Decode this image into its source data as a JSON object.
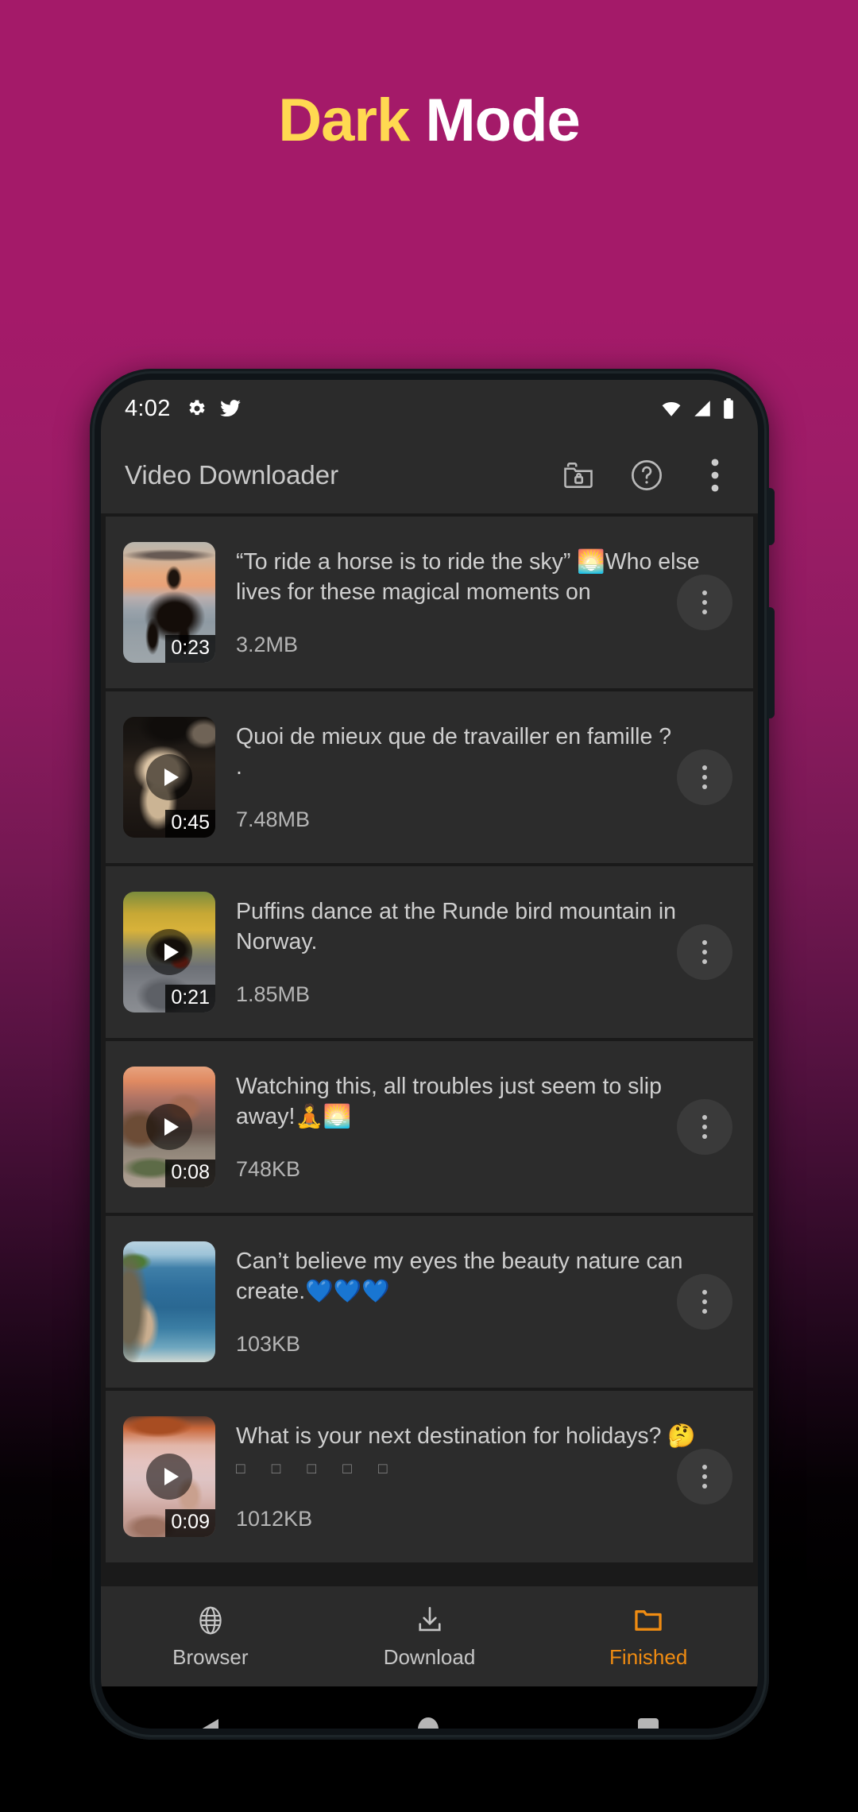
{
  "headline": {
    "highlight": "Dark",
    "rest": "Mode",
    "highlight_color": "#ffd951",
    "rest_color": "#ffffff"
  },
  "background": {
    "top_color": "#a41a69",
    "bottom_color": "#000000"
  },
  "statusbar": {
    "time": "4:02",
    "left_icons": [
      "gear-icon",
      "twitter-icon"
    ],
    "right_icons": [
      "wifi-icon",
      "signal-icon",
      "battery-icon"
    ]
  },
  "appbar": {
    "title": "Video Downloader",
    "actions": [
      {
        "name": "private-folder-icon"
      },
      {
        "name": "help-icon"
      },
      {
        "name": "overflow-menu-icon"
      }
    ]
  },
  "list": [
    {
      "title": "“To ride a horse is to ride the sky” 🌅Who else lives for these magical moments on",
      "size": "3.2MB",
      "duration": "0:23",
      "has_play": false,
      "thumb": "horse-on-beach-at-sunset"
    },
    {
      "title": "Quoi de mieux que de travailler en famille ?",
      "title_line2": ".",
      "size": "7.48MB",
      "duration": "0:45",
      "has_play": true,
      "thumb": "woman-with-black-hat"
    },
    {
      "title": "Puffins dance at the Runde bird mountain in Norway.",
      "size": "1.85MB",
      "duration": "0:21",
      "has_play": true,
      "thumb": "puffin-on-rock"
    },
    {
      "title": "Watching this, all troubles just seem to slip away!🧘🌅",
      "size": "748KB",
      "duration": "0:08",
      "has_play": true,
      "thumb": "pink-mountains-and-lake"
    },
    {
      "title": "Can’t believe my eyes the beauty nature can create.💙💙💙",
      "size": "103KB",
      "duration": "",
      "has_play": false,
      "thumb": "cliff-over-blue-ocean"
    },
    {
      "title": "What is your next destination for holidays? 🤔",
      "title_line2": "□ □ □ □ □",
      "size": "1012KB",
      "duration": "0:09",
      "has_play": true,
      "thumb": "sunset-terrace-by-the-sea"
    }
  ],
  "bottomnav": {
    "active_color": "#f08c12",
    "items": [
      {
        "label": "Browser",
        "icon": "globe-icon",
        "active": false
      },
      {
        "label": "Download",
        "icon": "download-icon",
        "active": false
      },
      {
        "label": "Finished",
        "icon": "folder-icon",
        "active": true
      }
    ]
  },
  "androidnav": {
    "items": [
      "back-button",
      "home-button",
      "recents-button"
    ]
  }
}
